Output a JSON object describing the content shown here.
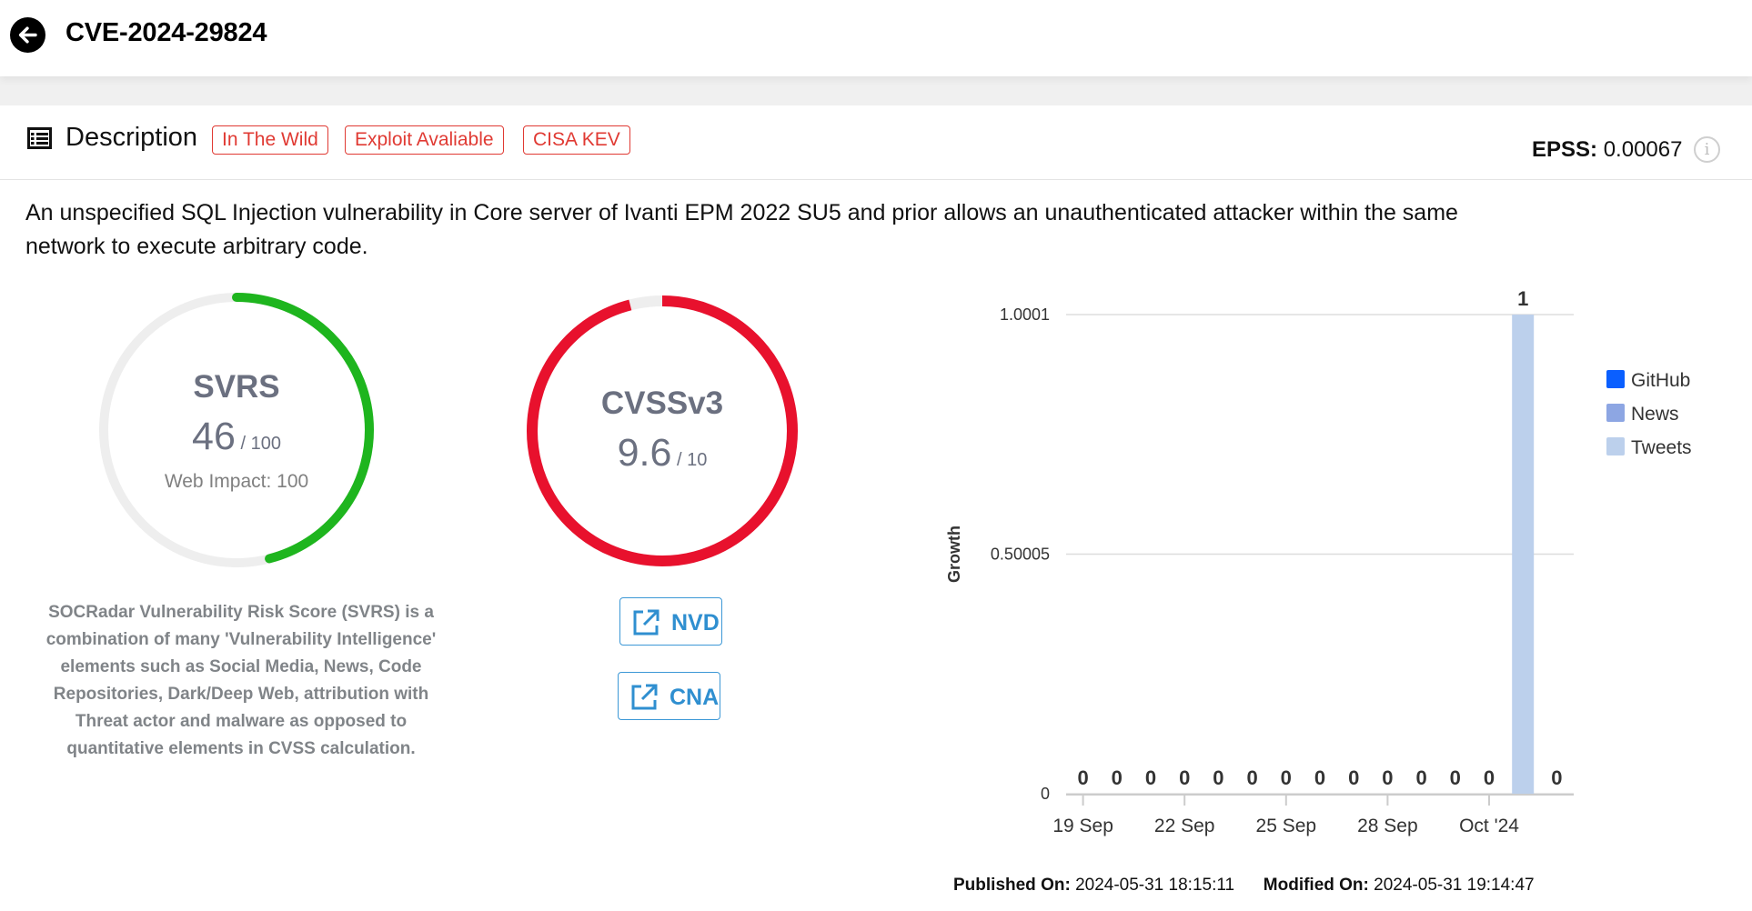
{
  "header": {
    "title": "CVE-2024-29824",
    "back_icon": "arrow-left-icon"
  },
  "description": {
    "heading": "Description",
    "tags": [
      "In The Wild",
      "Exploit Avaliable",
      "CISA KEV"
    ],
    "epss_label": "EPSS:",
    "epss_value": "0.00067",
    "info_icon": "i",
    "text": "An unspecified SQL Injection vulnerability in Core server of Ivanti EPM 2022 SU5 and prior allows an unauthenticated attacker within the same network to execute arbitrary code."
  },
  "svrs": {
    "label": "SVRS",
    "score": "46",
    "max": "/ 100",
    "score_value": 46,
    "max_value": 100,
    "web_impact": "Web Impact: 100",
    "note": "SOCRadar Vulnerability Risk Score (SVRS) is a combination of many 'Vulnerability Intelligence' elements such as Social Media, News, Code Repositories, Dark/Deep Web, attribution with Threat actor and malware as opposed to quantitative elements in CVSS calculation.",
    "color": "#1eb51e"
  },
  "cvss": {
    "label": "CVSSv3",
    "score": "9.6",
    "max": "/ 10",
    "score_value": 9.6,
    "max_value": 10,
    "color": "#e8112d"
  },
  "links": {
    "nvd": "NVD",
    "cna": "CNA"
  },
  "chart_data": {
    "type": "bar",
    "xlabel": "",
    "ylabel": "Growth",
    "ylim": [
      0,
      1.0001
    ],
    "yticks": [
      "1.0001",
      "0.50005",
      "0"
    ],
    "ytick_values": [
      1.0001,
      0.50005,
      0
    ],
    "xtick_labels": [
      "19 Sep",
      "22 Sep",
      "25 Sep",
      "28 Sep",
      "Oct '24"
    ],
    "xtick_indices": [
      0,
      3,
      6,
      9,
      12
    ],
    "categories": [
      "19 Sep",
      "20 Sep",
      "21 Sep",
      "22 Sep",
      "23 Sep",
      "24 Sep",
      "25 Sep",
      "26 Sep",
      "27 Sep",
      "28 Sep",
      "29 Sep",
      "30 Sep",
      "1 Oct",
      "2 Oct",
      "3 Oct"
    ],
    "totals": [
      0,
      0,
      0,
      0,
      0,
      0,
      0,
      0,
      0,
      0,
      0,
      0,
      0,
      1,
      0
    ],
    "series": [
      {
        "name": "GitHub",
        "color": "#0a5fff",
        "values": [
          0,
          0,
          0,
          0,
          0,
          0,
          0,
          0,
          0,
          0,
          0,
          0,
          0,
          0,
          0
        ]
      },
      {
        "name": "News",
        "color": "#8da6e3",
        "values": [
          0,
          0,
          0,
          0,
          0,
          0,
          0,
          0,
          0,
          0,
          0,
          0,
          0,
          0,
          0
        ]
      },
      {
        "name": "Tweets",
        "color": "#bcd0ec",
        "values": [
          0,
          0,
          0,
          0,
          0,
          0,
          0,
          0,
          0,
          0,
          0,
          0,
          0,
          1,
          0
        ]
      }
    ],
    "legend": "right",
    "grid": true
  },
  "dates": {
    "published_label": "Published On:",
    "published_value": "2024-05-31 18:15:11",
    "modified_label": "Modified On:",
    "modified_value": "2024-05-31 19:14:47"
  }
}
